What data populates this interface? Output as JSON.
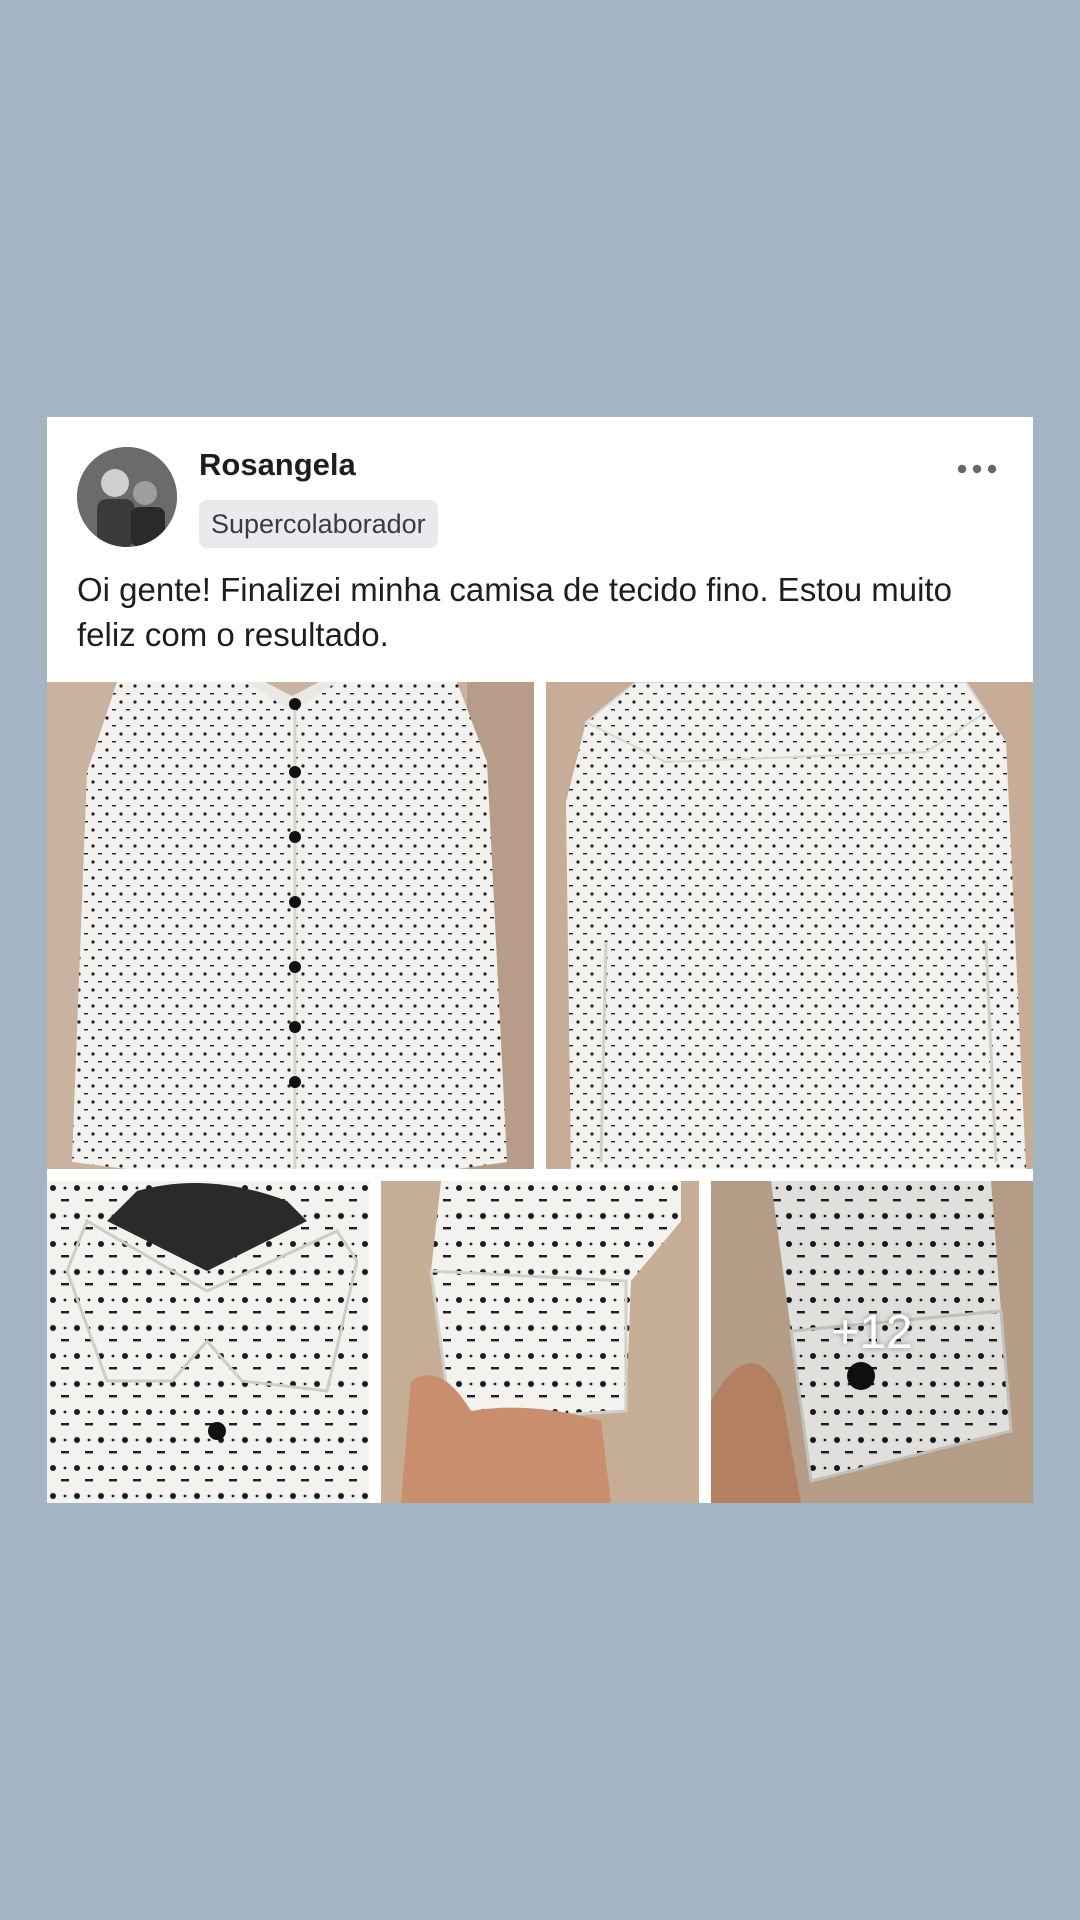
{
  "post": {
    "author": "Rosangela",
    "badge": "Supercolaborador",
    "text": "Oi gente! Finalizei minha camisa de tecido fino. Estou muito feliz com o resultado.",
    "more_photos_label": "+12"
  },
  "icons": {
    "options": "more-options-icon",
    "avatar": "user-avatar"
  },
  "colors": {
    "background": "#a3b4c3",
    "card": "#ffffff",
    "badge_bg": "#e8eaee",
    "text": "#1c1e21"
  }
}
